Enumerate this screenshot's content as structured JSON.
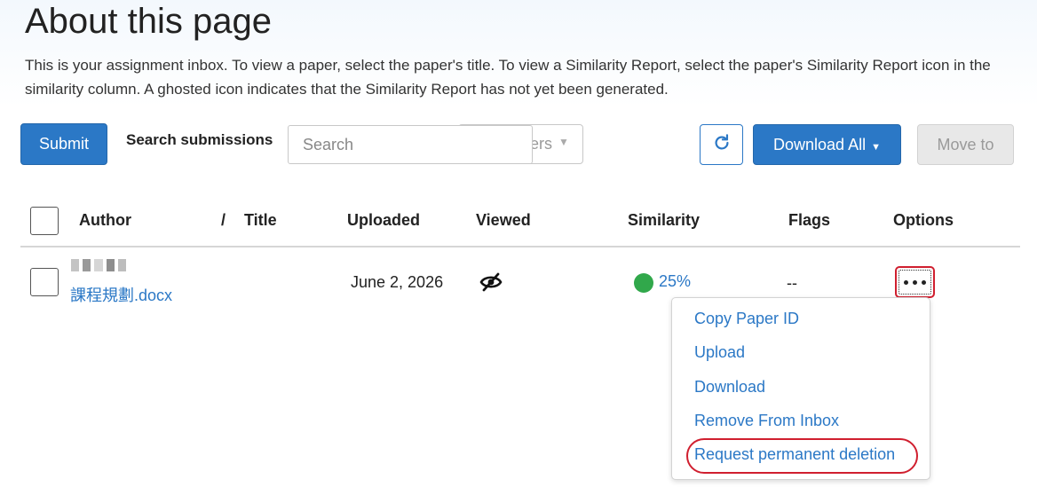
{
  "page": {
    "title": "About this page",
    "intro": "This is your assignment inbox. To view a paper, select the paper's title. To view a Similarity Report, select the paper's Similarity Report icon in the similarity column. A ghosted icon indicates that the Similarity Report has not yet been generated."
  },
  "toolbar": {
    "submit_label": "Submit",
    "search_label": "Search submissions",
    "search_placeholder": "Search",
    "filter_label": "ers",
    "refresh_icon": "refresh-icon",
    "download_all_label": "Download All",
    "move_to_label": "Move to"
  },
  "table": {
    "headers": {
      "author": "Author",
      "separator": "/",
      "title": "Title",
      "uploaded": "Uploaded",
      "viewed": "Viewed",
      "similarity": "Similarity",
      "flags": "Flags",
      "options": "Options"
    },
    "rows": [
      {
        "file_name": "課程規劃.docx",
        "uploaded": "June 2, 2026",
        "viewed_icon": "eye-slash-icon",
        "similarity": "25%",
        "similarity_color": "#31a84b",
        "flags": "--"
      }
    ]
  },
  "options_menu": {
    "items": [
      "Copy Paper ID",
      "Upload",
      "Download",
      "Remove From Inbox",
      "Request permanent deletion"
    ]
  },
  "colors": {
    "accent": "#2b78c6",
    "highlight": "#d01f2f"
  }
}
